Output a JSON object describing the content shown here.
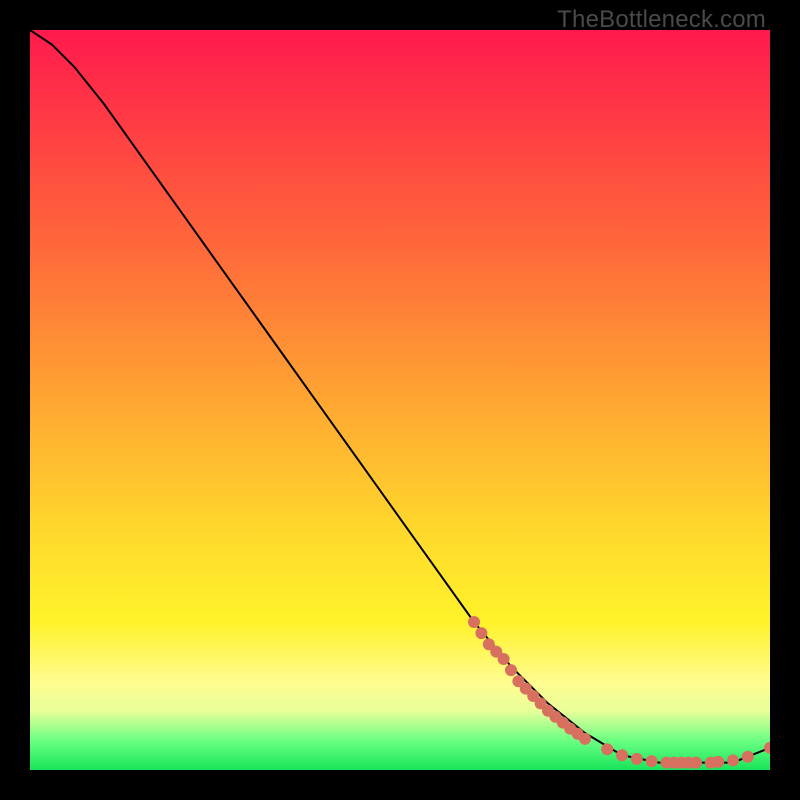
{
  "watermark": "TheBottleneck.com",
  "colors": {
    "background": "#000000",
    "gradient_top": "#ff1a4d",
    "gradient_mid1": "#ff6a3a",
    "gradient_mid2": "#ffd92c",
    "gradient_bottom": "#17e55a",
    "curve": "#000000",
    "dot": "#d87060"
  },
  "chart_data": {
    "type": "line",
    "title": "",
    "xlabel": "",
    "ylabel": "",
    "xlim": [
      0,
      100
    ],
    "ylim": [
      0,
      100
    ],
    "grid": false,
    "legend": false,
    "series": [
      {
        "name": "curve",
        "x": [
          0,
          3,
          6,
          10,
          15,
          20,
          25,
          30,
          35,
          40,
          45,
          50,
          55,
          60,
          65,
          70,
          75,
          80,
          85,
          90,
          95,
          100
        ],
        "y": [
          100,
          98,
          95,
          90,
          83,
          76,
          69,
          62,
          55,
          48,
          41,
          34,
          27,
          20,
          14,
          9,
          5,
          2,
          1,
          1,
          1,
          3
        ]
      }
    ],
    "dots": [
      {
        "x": 60,
        "y": 20
      },
      {
        "x": 61,
        "y": 18.5
      },
      {
        "x": 62,
        "y": 17
      },
      {
        "x": 63,
        "y": 16
      },
      {
        "x": 64,
        "y": 15
      },
      {
        "x": 65,
        "y": 13.5
      },
      {
        "x": 66,
        "y": 12
      },
      {
        "x": 67,
        "y": 11
      },
      {
        "x": 68,
        "y": 10
      },
      {
        "x": 69,
        "y": 9
      },
      {
        "x": 70,
        "y": 8
      },
      {
        "x": 71,
        "y": 7.2
      },
      {
        "x": 72,
        "y": 6.4
      },
      {
        "x": 73,
        "y": 5.6
      },
      {
        "x": 74,
        "y": 4.9
      },
      {
        "x": 75,
        "y": 4.2
      },
      {
        "x": 78,
        "y": 2.8
      },
      {
        "x": 80,
        "y": 2.0
      },
      {
        "x": 82,
        "y": 1.5
      },
      {
        "x": 84,
        "y": 1.2
      },
      {
        "x": 86,
        "y": 1.0
      },
      {
        "x": 87,
        "y": 1.0
      },
      {
        "x": 88,
        "y": 1.0
      },
      {
        "x": 89,
        "y": 1.0
      },
      {
        "x": 90,
        "y": 1.0
      },
      {
        "x": 92,
        "y": 1.0
      },
      {
        "x": 93,
        "y": 1.1
      },
      {
        "x": 95,
        "y": 1.3
      },
      {
        "x": 97,
        "y": 1.8
      },
      {
        "x": 100,
        "y": 3.0
      }
    ]
  }
}
